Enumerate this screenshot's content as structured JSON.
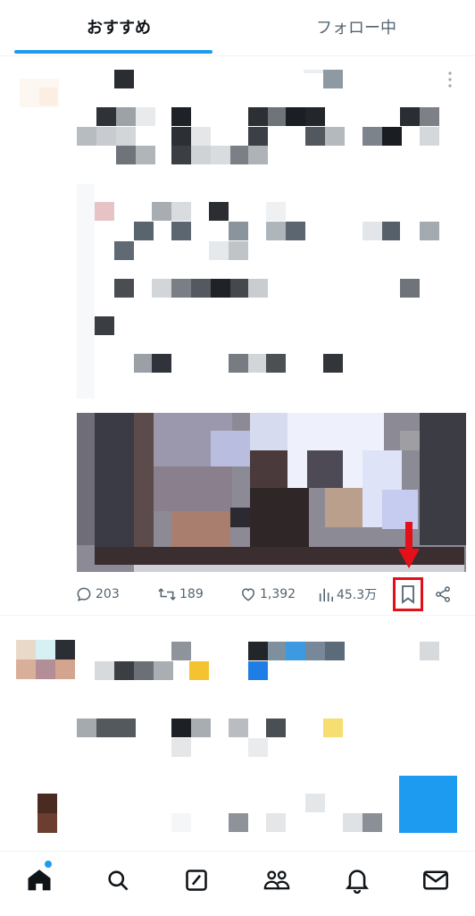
{
  "tabs": {
    "recommended": "おすすめ",
    "following": "フォロー中"
  },
  "post": {
    "replies": "203",
    "reposts": "189",
    "likes": "1,392",
    "views": "45.3万"
  },
  "icons": {
    "more": "more-icon",
    "reply": "reply-icon",
    "repost": "repost-icon",
    "like": "like-icon",
    "views": "views-icon",
    "bookmark": "bookmark-icon",
    "share": "share-icon",
    "home": "home-icon",
    "search": "search-icon",
    "grok": "grok-icon",
    "communities": "communities-icon",
    "notifications": "notifications-icon",
    "messages": "messages-icon"
  },
  "colors": {
    "accent": "#1d9bf0",
    "annotation": "#e3101a",
    "muted": "#536471"
  }
}
